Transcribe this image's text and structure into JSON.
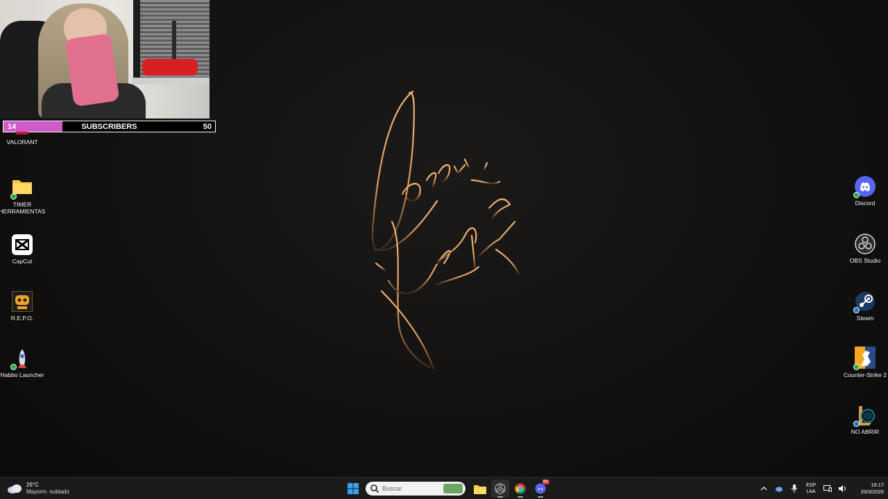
{
  "webcam": {
    "subscribers_bar": {
      "current": "14",
      "label": "SUBSCRIBERS",
      "goal": "50",
      "progress_fraction": 0.28,
      "fill_color": "#cf5ac9"
    }
  },
  "desktop": {
    "left_icons": [
      {
        "label": "VALORANT"
      },
      {
        "label": "TIMER HERRAMIENTAS"
      },
      {
        "label": "CapCut"
      },
      {
        "label": "R.E.P.O."
      },
      {
        "label": "Habbo Launcher"
      }
    ],
    "right_icons": [
      {
        "label": "Discord"
      },
      {
        "label": "OBS Studio"
      },
      {
        "label": "Steam"
      },
      {
        "label": "Counter-Strike 2"
      },
      {
        "label": "NO ABRIR"
      }
    ]
  },
  "taskbar": {
    "weather": {
      "temperature": "26°C",
      "condition": "Mayorm. nublado"
    },
    "search": {
      "placeholder": "Buscar"
    },
    "pinned": [
      "start-icon",
      "file-explorer-icon",
      "obs-icon",
      "chrome-icon",
      "discord-icon"
    ],
    "discord_badge": "99+",
    "tray": {
      "language": "ESP",
      "layout": "LAA",
      "time": "16:17",
      "date": "20/3/2026"
    }
  },
  "colors": {
    "accent_signature": "#e3a86a",
    "subscriber_fill": "#cf5ac9",
    "taskbar_bg": "#1b1b1b"
  }
}
